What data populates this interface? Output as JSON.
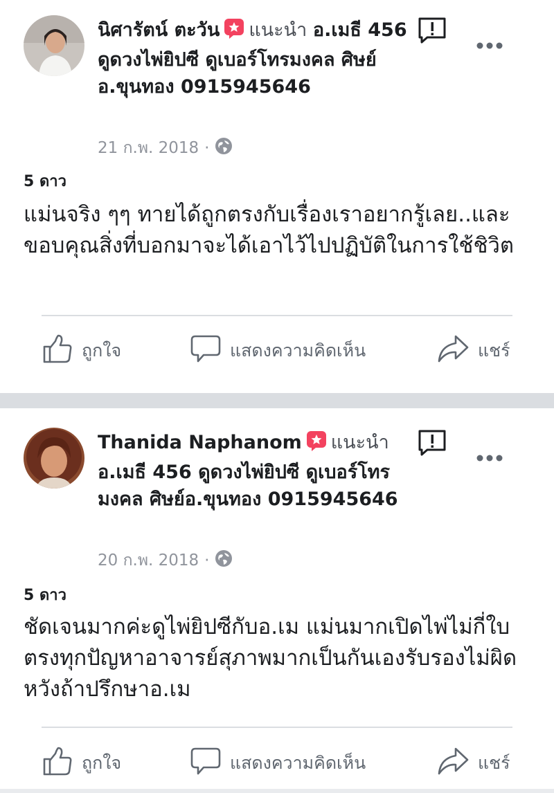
{
  "reviews": [
    {
      "author": "นิศารัตน์ ตะวัน",
      "recommends_label": "แนะนำ",
      "target": "อ.เมธี 456 ดูดวงไพ่ยิปซี ดูเบอร์โทรมงคล ศิษย์อ.ขุนทอง 0915945646",
      "date": "21 ก.พ. 2018",
      "separator": "·",
      "rating": "5 ดาว",
      "text": "แม่นจริง ๆๆ ทายได้ถูกตรงกับเรื่องเราอยากรู้เลย..และขอบคุณสิ่งที่บอกมาจะได้เอาไว้ไปปฏิบัติในการใช้ชิวิต"
    },
    {
      "author": "Thanida Naphanom",
      "recommends_label": "แนะนำ",
      "target": "อ.เมธี 456 ดูดวงไพ่ยิปซี ดูเบอร์โทรมงคล ศิษย์อ.ขุนทอง 0915945646",
      "date": "20 ก.พ. 2018",
      "separator": "·",
      "rating": "5 ดาว",
      "text": "ชัดเจนมากค่ะดูไพ่ยิปซีกับอ.เม แม่นมากเปิดไพ่ไม่กี่ใบตรงทุกปัญหาอาจารย์สุภาพมากเป็นกันเองรับรองไม่ผิดหวังถ้าปรึกษาอ.เม"
    }
  ],
  "actions": {
    "like": "ถูกใจ",
    "comment": "แสดงความคิดเห็น",
    "share": "แชร์"
  },
  "colors": {
    "recommend_badge": "#f3425f",
    "icon_gray": "#606770",
    "divider": "#dadde1"
  },
  "icons": {
    "recommend": "recommend-badge-icon",
    "report": "report-icon",
    "more": "more-options-icon",
    "privacy": "globe-icon",
    "like": "thumbs-up-icon",
    "comment": "comment-bubble-icon",
    "share": "share-arrow-icon"
  }
}
